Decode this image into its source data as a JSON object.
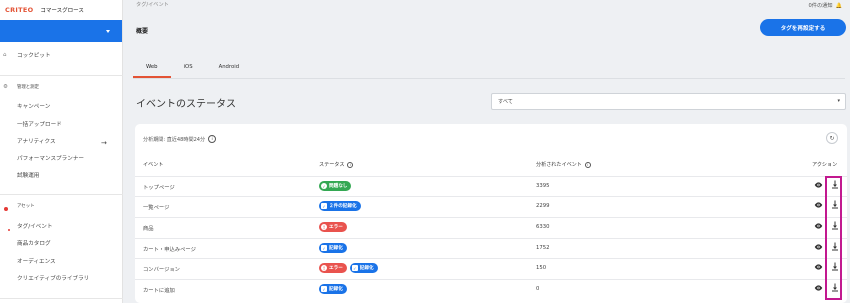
{
  "sidebar": {
    "brand": "CRITEO",
    "app_name": "コマースグロース",
    "items": {
      "cockpit": "コックピット",
      "management": "管理と測定",
      "campaign": "キャンペーン",
      "bulk_upload": "一括アップロード",
      "analytics": "アナリティクス",
      "performance_planner": "パフォーマンスプランナー",
      "experiment": "試験運用",
      "assets": "アセット",
      "tag_events": "タグ/イベント",
      "product_catalog": "商品カタログ",
      "audience": "オーディエンス",
      "creative_library": "クリエイティブのライブラリ"
    }
  },
  "header": {
    "breadcrumb": "タグ/イベント",
    "notifications": "0件の通知"
  },
  "main": {
    "title": "概要",
    "reset_button": "タグを再設定する",
    "tabs": [
      "Web",
      "iOS",
      "Android"
    ],
    "status_title": "イベントのステータス",
    "filter_value": "すべて",
    "period": "分析期間: 直近48時間24分",
    "columns": {
      "event": "イベント",
      "status": "ステータス",
      "analyzed": "分析されたイベント",
      "action": "アクション"
    },
    "rows": [
      {
        "event": "トップページ",
        "badges": [
          {
            "kind": "green",
            "icon": "✓",
            "label": "問題なし"
          }
        ],
        "analyzed": "3395"
      },
      {
        "event": "一覧ページ",
        "badges": [
          {
            "kind": "blue",
            "icon": "✓",
            "label": "２件の記録化"
          }
        ],
        "analyzed": "2299"
      },
      {
        "event": "商品",
        "badges": [
          {
            "kind": "red",
            "icon": "!",
            "label": "エラー"
          }
        ],
        "analyzed": "6330"
      },
      {
        "event": "カート・申込みページ",
        "badges": [
          {
            "kind": "blue",
            "icon": "✓",
            "label": "記録化"
          }
        ],
        "analyzed": "1752"
      },
      {
        "event": "コンバージョン",
        "badges": [
          {
            "kind": "red",
            "icon": "!",
            "label": "エラー"
          },
          {
            "kind": "blue",
            "icon": "✓",
            "label": "記録化"
          }
        ],
        "analyzed": "150"
      },
      {
        "event": "カートに追加",
        "badges": [
          {
            "kind": "blue",
            "icon": "✓",
            "label": "記録化"
          }
        ],
        "analyzed": "0"
      }
    ]
  },
  "colors": {
    "accent": "#1a73e8",
    "brand": "#e35335",
    "success": "#34a853",
    "error": "#e9534e",
    "highlight": "#c2188f"
  }
}
